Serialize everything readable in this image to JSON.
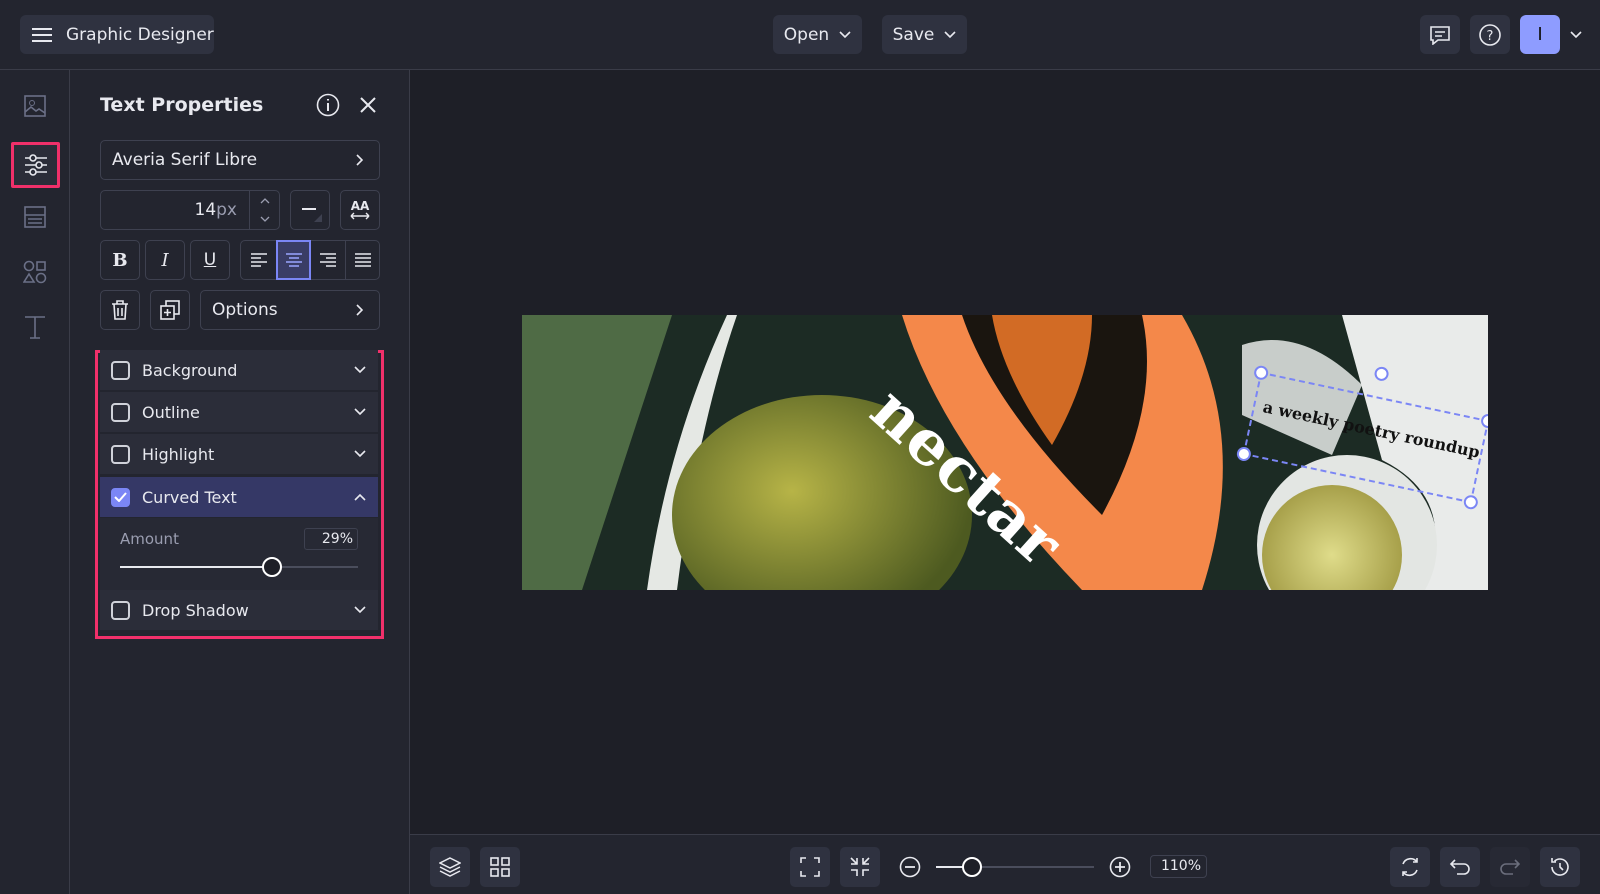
{
  "app": {
    "title": "Graphic Designer",
    "open_label": "Open",
    "save_label": "Save",
    "avatar_initial": "I"
  },
  "panel": {
    "title": "Text Properties",
    "font": "Averia Serif Libre",
    "font_size": "14",
    "font_unit": "px",
    "options_label": "Options",
    "sections": [
      {
        "label": "Background",
        "checked": false
      },
      {
        "label": "Outline",
        "checked": false
      },
      {
        "label": "Highlight",
        "checked": false
      },
      {
        "label": "Curved Text",
        "checked": true
      },
      {
        "label": "Drop Shadow",
        "checked": false
      }
    ],
    "amount_label": "Amount",
    "amount_value": "29%",
    "amount_fraction": 0.29
  },
  "canvas": {
    "title_text": "nectar",
    "curved_text": "a weekly poetry roundup"
  },
  "zoom": {
    "value": "110%",
    "fraction": 0.23
  },
  "colors": {
    "accent": "#f0306a",
    "selection": "#7b86f5",
    "avatar": "#8e9cff"
  }
}
